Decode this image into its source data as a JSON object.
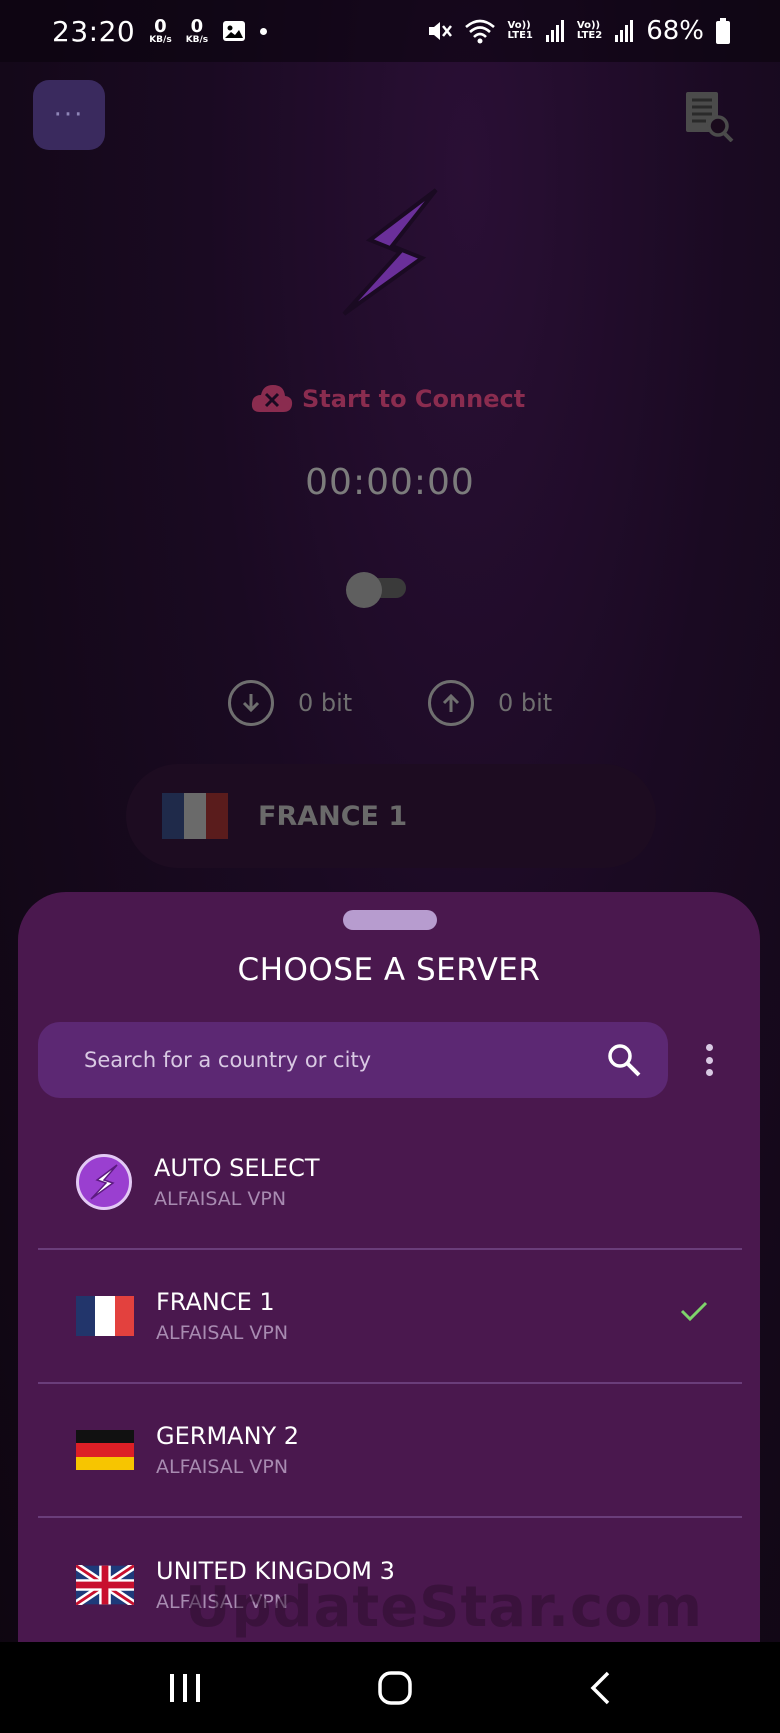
{
  "status_bar": {
    "time": "23:20",
    "net_down_value": "0",
    "net_down_unit": "KB/s",
    "net_up_value": "0",
    "net_up_unit": "KB/s",
    "sim1_top": "Vo))",
    "sim1_bottom": "LTE1",
    "sim2_top": "Vo))",
    "sim2_bottom": "LTE2",
    "battery": "68%"
  },
  "main": {
    "connect_status": "Start to Connect",
    "timer": "00:00:00",
    "download": "0 bit",
    "upload": "0 bit",
    "selected_server": "FRANCE 1"
  },
  "sheet": {
    "title": "CHOOSE A SERVER",
    "search_placeholder": "Search for a country or city",
    "servers": [
      {
        "name": "AUTO SELECT",
        "provider": "ALFAISAL VPN",
        "icon": "bolt-icon"
      },
      {
        "name": "FRANCE 1",
        "provider": "ALFAISAL VPN",
        "icon": "france-flag-icon",
        "selected": true
      },
      {
        "name": "GERMANY 2",
        "provider": "ALFAISAL VPN",
        "icon": "germany-flag-icon"
      },
      {
        "name": "UNITED KINGDOM 3",
        "provider": "ALFAISAL VPN",
        "icon": "uk-flag-icon"
      }
    ]
  },
  "watermark": "UpdateStar.com",
  "colors": {
    "sheet_bg": "#4a184e",
    "search_bg": "#5c2873",
    "accent_bolt": "#8a3fc8",
    "check": "#7ed36b"
  }
}
